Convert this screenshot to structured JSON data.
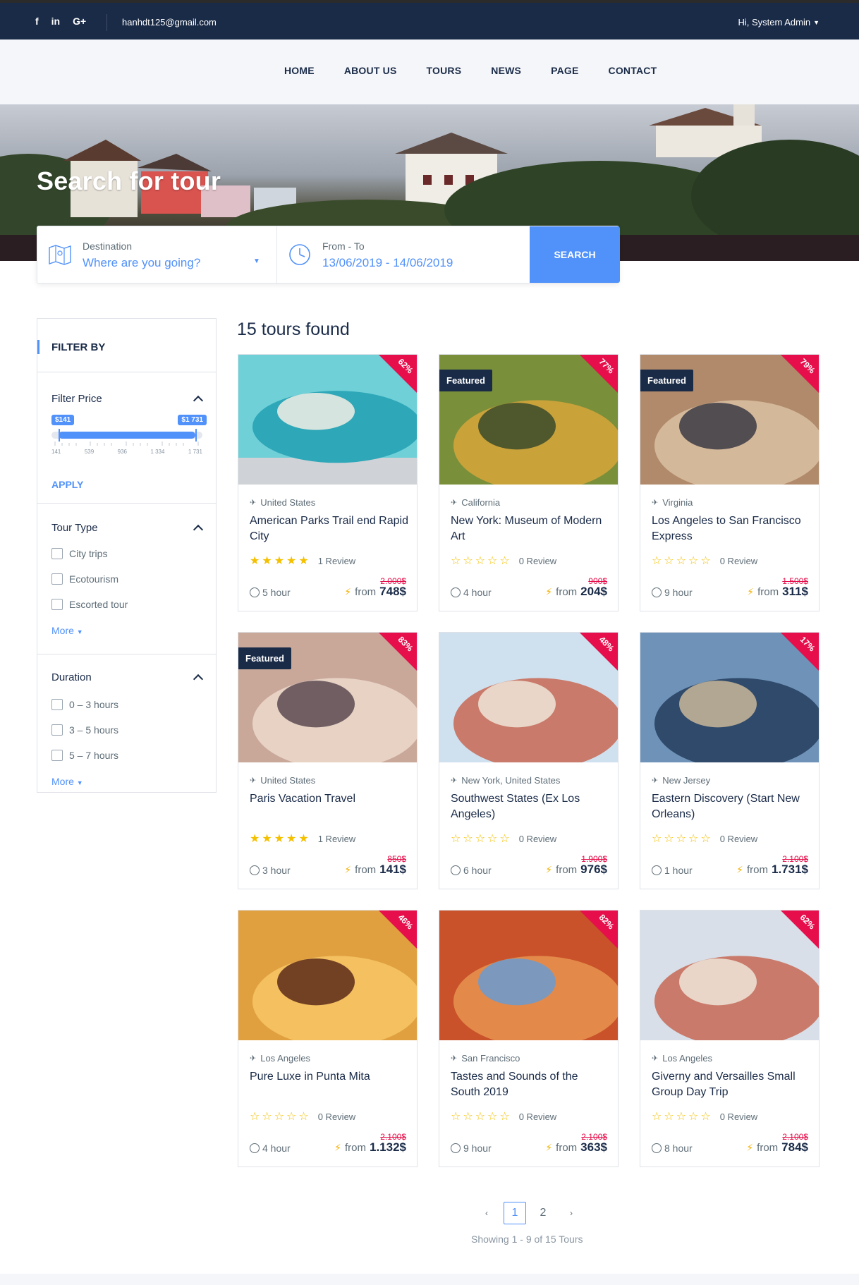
{
  "topbar": {
    "social": [
      {
        "name": "facebook",
        "glyph": "f"
      },
      {
        "name": "linkedin",
        "glyph": "in"
      },
      {
        "name": "google-plus",
        "glyph": "G+"
      }
    ],
    "email": "hanhdt125@gmail.com",
    "user": "Hi, System Admin"
  },
  "nav": [
    "HOME",
    "ABOUT US",
    "TOURS",
    "NEWS",
    "PAGE",
    "CONTACT"
  ],
  "hero": {
    "title": "Search for tour"
  },
  "search": {
    "destination_label": "Destination",
    "destination_placeholder": "Where are you going?",
    "date_label": "From - To",
    "date_value": "13/06/2019 - 14/06/2019",
    "button": "SEARCH"
  },
  "filter": {
    "heading": "FILTER BY",
    "price": {
      "title": "Filter Price",
      "min_label": "$141",
      "max_label": "$1 731",
      "ticks": [
        "141",
        "539",
        "936",
        "1 334",
        "1 731"
      ],
      "apply": "APPLY"
    },
    "tour_type": {
      "title": "Tour Type",
      "options": [
        "City trips",
        "Ecotourism",
        "Escorted tour"
      ],
      "more": "More"
    },
    "duration": {
      "title": "Duration",
      "options": [
        "0 – 3 hours",
        "3 – 5 hours",
        "5 – 7 hours"
      ],
      "more": "More"
    }
  },
  "results": {
    "count_text": "15 tours found",
    "tours": [
      {
        "location": "United States",
        "title": "American Parks Trail end Rapid City",
        "discount": "62%",
        "featured": "",
        "rating": 5,
        "reviews": "1 Review",
        "old_price": "2.000$",
        "duration": "5 hour",
        "from": "from",
        "price": "748$"
      },
      {
        "location": "California",
        "title": "New York: Museum of Modern Art",
        "discount": "77%",
        "featured": "Featured",
        "rating": 0,
        "reviews": "0 Review",
        "old_price": "900$",
        "duration": "4 hour",
        "from": "from",
        "price": "204$"
      },
      {
        "location": "Virginia",
        "title": "Los Angeles to San Francisco Express",
        "discount": "79%",
        "featured": "Featured",
        "rating": 0,
        "reviews": "0 Review",
        "old_price": "1.500$",
        "duration": "9 hour",
        "from": "from",
        "price": "311$"
      },
      {
        "location": "United States",
        "title": "Paris Vacation Travel",
        "discount": "83%",
        "featured": "Featured",
        "rating": 5,
        "reviews": "1 Review",
        "old_price": "850$",
        "duration": "3 hour",
        "from": "from",
        "price": "141$"
      },
      {
        "location": "New York, United States",
        "title": "Southwest States (Ex Los Angeles)",
        "discount": "48%",
        "featured": "",
        "rating": 0,
        "reviews": "0 Review",
        "old_price": "1.900$",
        "duration": "6 hour",
        "from": "from",
        "price": "976$"
      },
      {
        "location": "New Jersey",
        "title": "Eastern Discovery (Start New Orleans)",
        "discount": "17%",
        "featured": "",
        "rating": 0,
        "reviews": "0 Review",
        "old_price": "2.100$",
        "duration": "1 hour",
        "from": "from",
        "price": "1.731$"
      },
      {
        "location": "Los Angeles",
        "title": "Pure Luxe in Punta Mita",
        "discount": "46%",
        "featured": "",
        "rating": 0,
        "reviews": "0 Review",
        "old_price": "2.100$",
        "duration": "4 hour",
        "from": "from",
        "price": "1.132$"
      },
      {
        "location": "San Francisco",
        "title": "Tastes and Sounds of the South 2019",
        "discount": "82%",
        "featured": "",
        "rating": 0,
        "reviews": "0 Review",
        "old_price": "2.100$",
        "duration": "9 hour",
        "from": "from",
        "price": "363$"
      },
      {
        "location": "Los Angeles",
        "title": "Giverny and Versailles Small Group Day Trip",
        "discount": "62%",
        "featured": "",
        "rating": 0,
        "reviews": "0 Review",
        "old_price": "2.100$",
        "duration": "8 hour",
        "from": "from",
        "price": "784$"
      }
    ]
  },
  "pagination": {
    "prev": "‹",
    "pages": [
      "1",
      "2"
    ],
    "active": "1",
    "next": "›",
    "showing": "Showing 1 - 9 of 15 Tours"
  },
  "colors": {
    "navy": "#1a2b48",
    "accent": "#5191fa",
    "ribbon": "#e60f4b",
    "star": "#f4c000"
  }
}
